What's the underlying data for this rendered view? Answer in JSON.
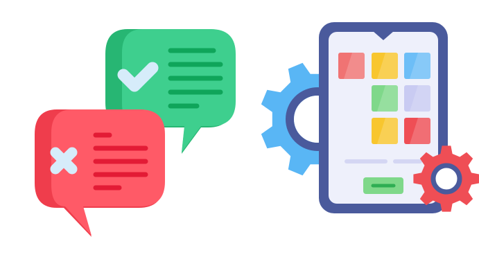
{
  "scene": {
    "background_color": "#ffffff"
  },
  "approved_bubble": {
    "icon": "check-icon",
    "color_main": "#3ECF8E",
    "color_shade": "#27B673",
    "color_lines": "#0FA55A",
    "color_check": "#D6ECFA",
    "text_line_count": 5
  },
  "rejected_bubble": {
    "icon": "close-icon",
    "color_main": "#FF5A67",
    "color_shade": "#EF3D4C",
    "color_lines": "#E31B35",
    "color_cross": "#D6ECFA",
    "text_line_count": 5
  },
  "device": {
    "icon": "tablet-icon",
    "frame_color": "#4A5A9C",
    "screen_color": "#EEF0FB",
    "button_color": "#7FD88A",
    "button_inner_color": "#2FAE53",
    "tiles": [
      {
        "color": "#F07373"
      },
      {
        "color": "#F8C62E"
      },
      {
        "color": "#6DBEF7"
      },
      {
        "color": "#7FD88A"
      },
      {
        "color": "#C9CBF2"
      },
      {
        "color": "#F8C62E"
      },
      {
        "color": "#EF4E55"
      }
    ]
  },
  "gears": {
    "large": {
      "icon": "gear-icon",
      "color": "#59B6F5",
      "hub_color": "#4A5A9C"
    },
    "small": {
      "icon": "gear-icon",
      "color": "#EF4E55",
      "hub_color": "#4A5A9C"
    }
  }
}
